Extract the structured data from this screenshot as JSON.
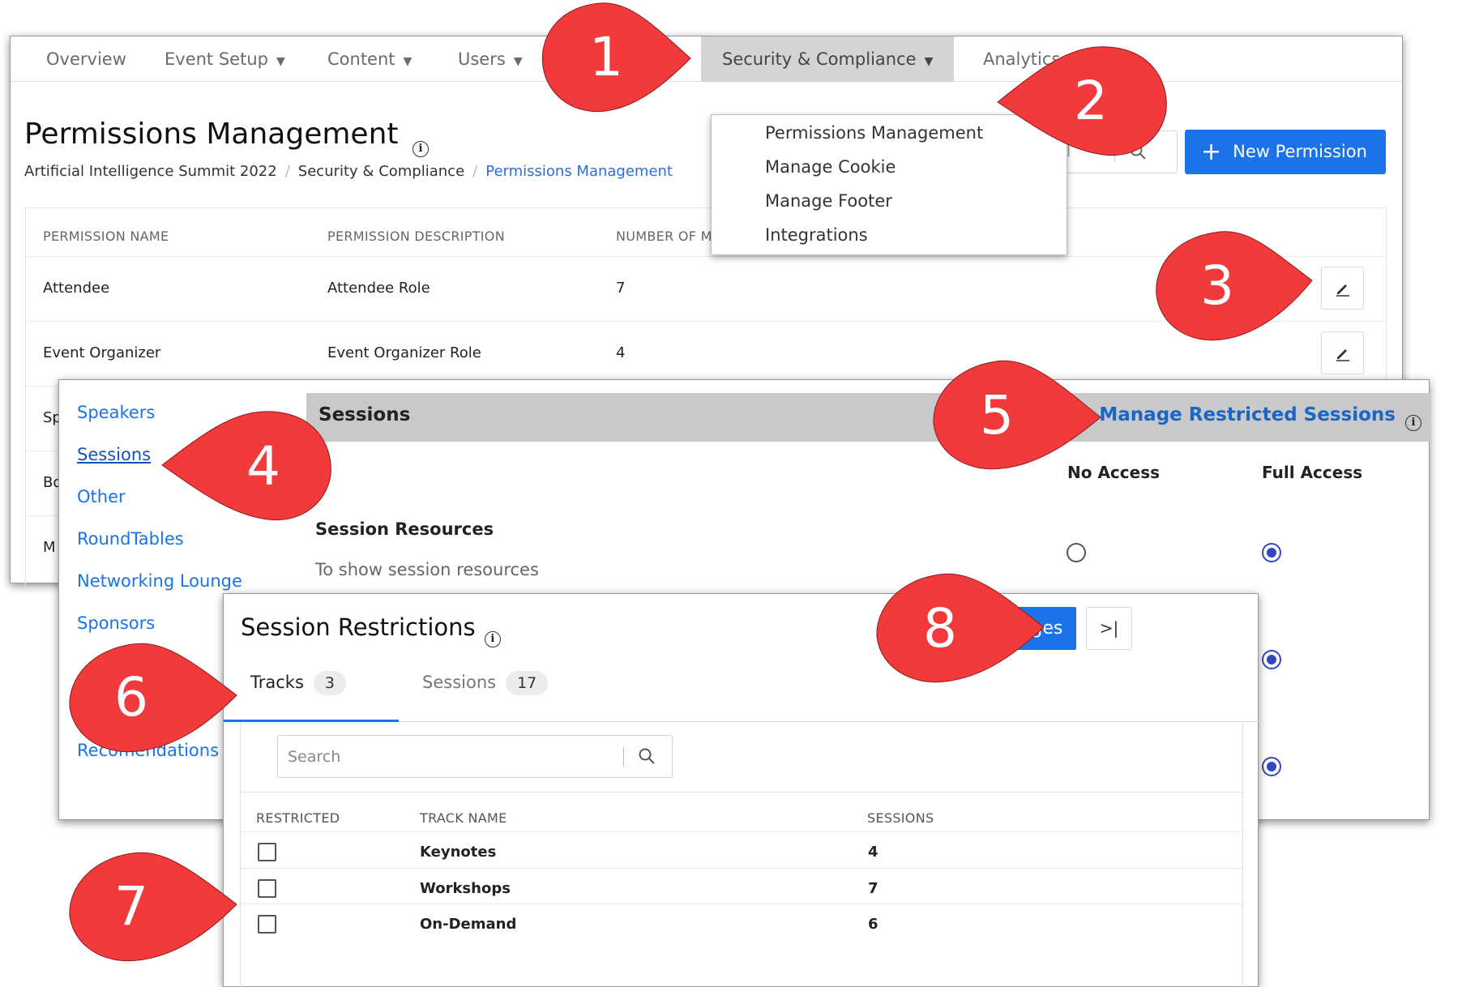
{
  "nav": {
    "items": [
      {
        "label": "Overview",
        "has_caret": false
      },
      {
        "label": "Event Setup",
        "has_caret": true
      },
      {
        "label": "Content",
        "has_caret": true
      },
      {
        "label": "Users",
        "has_caret": true
      },
      {
        "label": "Security & Compliance",
        "has_caret": true,
        "active": true
      },
      {
        "label": "Analytics",
        "has_caret": true
      }
    ],
    "caret": "▼"
  },
  "dropdown": {
    "items": [
      "Permissions Management",
      "Manage Cookie",
      "Manage Footer",
      "Integrations"
    ]
  },
  "page": {
    "title": "Permissions Management",
    "info_glyph": "i",
    "breadcrumb": [
      "Artificial Intelligence Summit 2022",
      "Security & Compliance",
      "Permissions Management"
    ],
    "breadcrumb_sep": "/",
    "search_placeholder_visible": "ail",
    "new_permission_label": "New Permission"
  },
  "permissions_table": {
    "headers": [
      "PERMISSION NAME",
      "PERMISSION DESCRIPTION",
      "NUMBER OF MEMBERS"
    ],
    "rows": [
      {
        "name": "Attendee",
        "description": "Attendee Role",
        "members": "7"
      },
      {
        "name": "Event Organizer",
        "description": "Event Organizer Role",
        "members": "4"
      },
      {
        "name": "Sp"
      },
      {
        "name": "Bo"
      },
      {
        "name": "M"
      }
    ]
  },
  "access_panel": {
    "sidebar": [
      "Speakers",
      "Sessions",
      "Other",
      "RoundTables",
      "Networking Lounge",
      "Sponsors",
      "Recomendations"
    ],
    "active_sidebar": "Sessions",
    "section_title": "Sessions",
    "manage_link": "Manage Restricted Sessions",
    "columns": [
      "No Access",
      "Full Access"
    ],
    "resource": {
      "title": "Session Resources",
      "description": "To show session resources"
    },
    "radios": [
      {
        "no_access": false,
        "full_access": true
      },
      {
        "full_access": true
      },
      {
        "full_access": true
      }
    ]
  },
  "restrictions": {
    "title": "Session Restrictions",
    "save_label": "Save Changes",
    "last_glyph": ">|",
    "tabs": [
      {
        "label": "Tracks",
        "count": "3",
        "active": true
      },
      {
        "label": "Sessions",
        "count": "17",
        "active": false
      }
    ],
    "search_placeholder": "Search",
    "headers": [
      "RESTRICTED",
      "TRACK NAME",
      "SESSIONS"
    ],
    "rows": [
      {
        "name": "Keynotes",
        "sessions": "4",
        "restricted": false
      },
      {
        "name": "Workshops",
        "sessions": "7",
        "restricted": false
      },
      {
        "name": "On-Demand",
        "sessions": "6",
        "restricted": false
      }
    ]
  },
  "callouts": [
    "1",
    "2",
    "3",
    "4",
    "5",
    "6",
    "7",
    "8"
  ],
  "colors": {
    "accent": "#1a73e8",
    "callout": "#f2393b",
    "radio": "#3047c0"
  }
}
